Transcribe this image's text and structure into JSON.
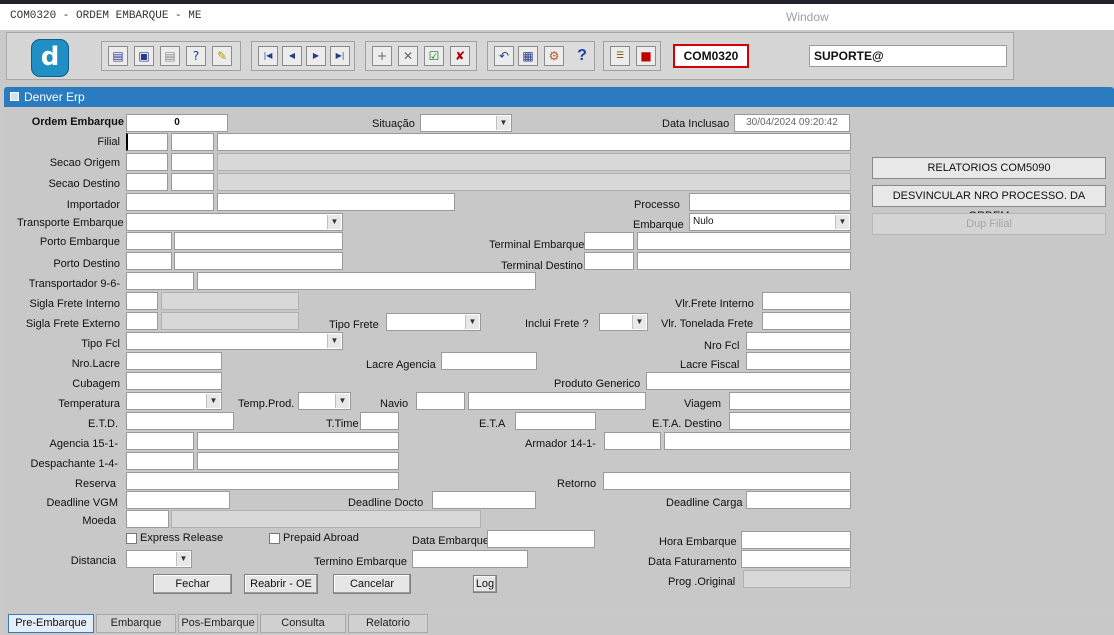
{
  "window": {
    "title": "COM0320 - ORDEM EMBARQUE - ME",
    "menu_label": "Window"
  },
  "toolbar": {
    "logo_letter": "d",
    "form_code": "COM0320",
    "user": "SUPORTE@",
    "accent": "#d40000"
  },
  "panel": {
    "title": "Denver Erp"
  },
  "fields": {
    "ordem_embarque": {
      "label": "Ordem Embarque",
      "value": "0"
    },
    "situacao": {
      "label": "Situação",
      "value": ""
    },
    "data_inclusao": {
      "label": "Data Inclusao",
      "value": "30/04/2024 09:20:42"
    },
    "filial": {
      "label": "Filial"
    },
    "secao_origem": {
      "label": "Secao Origem"
    },
    "secao_destino": {
      "label": "Secao Destino"
    },
    "importador": {
      "label": "Importador"
    },
    "processo": {
      "label": "Processo"
    },
    "transporte_embarque": {
      "label": "Transporte Embarque"
    },
    "embarque": {
      "label": "Embarque",
      "value": "Nulo"
    },
    "porto_embarque": {
      "label": "Porto Embarque"
    },
    "terminal_embarque": {
      "label": "Terminal Embarque"
    },
    "porto_destino": {
      "label": "Porto Destino"
    },
    "terminal_destino": {
      "label": "Terminal Destino"
    },
    "transportador": {
      "label": "Transportador 9-6-"
    },
    "sigla_frete_interno": {
      "label": "Sigla Frete Interno"
    },
    "vlr_frete_interno": {
      "label": "Vlr.Frete Interno"
    },
    "sigla_frete_externo": {
      "label": "Sigla Frete Externo"
    },
    "tipo_frete": {
      "label": "Tipo Frete"
    },
    "inclui_frete": {
      "label": "Inclui Frete ?"
    },
    "vlr_tonelada_frete": {
      "label": "Vlr. Tonelada Frete"
    },
    "tipo_fcl": {
      "label": "Tipo Fcl"
    },
    "nro_fcl": {
      "label": "Nro Fcl"
    },
    "nro_lacre": {
      "label": "Nro.Lacre"
    },
    "lacre_agencia": {
      "label": "Lacre Agencia"
    },
    "lacre_fiscal": {
      "label": "Lacre Fiscal"
    },
    "cubagem": {
      "label": "Cubagem"
    },
    "produto_generico": {
      "label": "Produto Generico"
    },
    "temperatura": {
      "label": "Temperatura"
    },
    "temp_prod": {
      "label": "Temp.Prod."
    },
    "navio": {
      "label": "Navio"
    },
    "viagem": {
      "label": "Viagem"
    },
    "etd": {
      "label": "E.T.D."
    },
    "ttime": {
      "label": "T.Time"
    },
    "eta": {
      "label": "E.T.A"
    },
    "eta_destino": {
      "label": "E.T.A. Destino"
    },
    "agencia": {
      "label": "Agencia 15-1-"
    },
    "armador": {
      "label": "Armador 14-1-"
    },
    "despachante": {
      "label": "Despachante 1-4-"
    },
    "reserva": {
      "label": "Reserva"
    },
    "retorno": {
      "label": "Retorno"
    },
    "deadline_vgm": {
      "label": "Deadline VGM"
    },
    "deadline_docto": {
      "label": "Deadline  Docto"
    },
    "deadline_carga": {
      "label": "Deadline Carga"
    },
    "moeda": {
      "label": "Moeda"
    },
    "express_release": {
      "label": "Express Release",
      "checked": false
    },
    "prepaid_abroad": {
      "label": "Prepaid Abroad",
      "checked": false
    },
    "data_embarque": {
      "label": "Data Embarque"
    },
    "hora_embarque": {
      "label": "Hora Embarque"
    },
    "distancia": {
      "label": "Distancia"
    },
    "termino_embarque": {
      "label": "Termino Embarque"
    },
    "data_faturamento": {
      "label": "Data Faturamento"
    },
    "prog_original": {
      "label": "Prog .Original"
    }
  },
  "buttons": {
    "fechar": "Fechar",
    "reabrir": "Reabrir - OE",
    "cancelar": "Cancelar",
    "log": "Log"
  },
  "side_buttons": {
    "relatorios": "RELATORIOS COM5090",
    "desvincular": "DESVINCULAR NRO PROCESSO. DA ORDEM",
    "dup_filial": "Dup Filial"
  },
  "tabs": [
    {
      "label": "Pre-Embarque",
      "active": true
    },
    {
      "label": "Embarque",
      "active": false
    },
    {
      "label": "Pos-Embarque",
      "active": false
    },
    {
      "label": "Consulta",
      "active": false
    },
    {
      "label": "Relatorio",
      "active": false
    }
  ],
  "icons": [
    "save-icon",
    "window-icon",
    "print-icon",
    "help-query-icon",
    "edit-query-icon",
    "first-record-icon",
    "prev-record-icon",
    "next-record-icon",
    "last-record-icon",
    "insert-record-icon",
    "delete-record-icon",
    "search-record-icon",
    "clear-record-icon",
    "undo-icon",
    "list-icon",
    "tools-icon",
    "question-icon",
    "menu-icon",
    "exit-icon"
  ]
}
